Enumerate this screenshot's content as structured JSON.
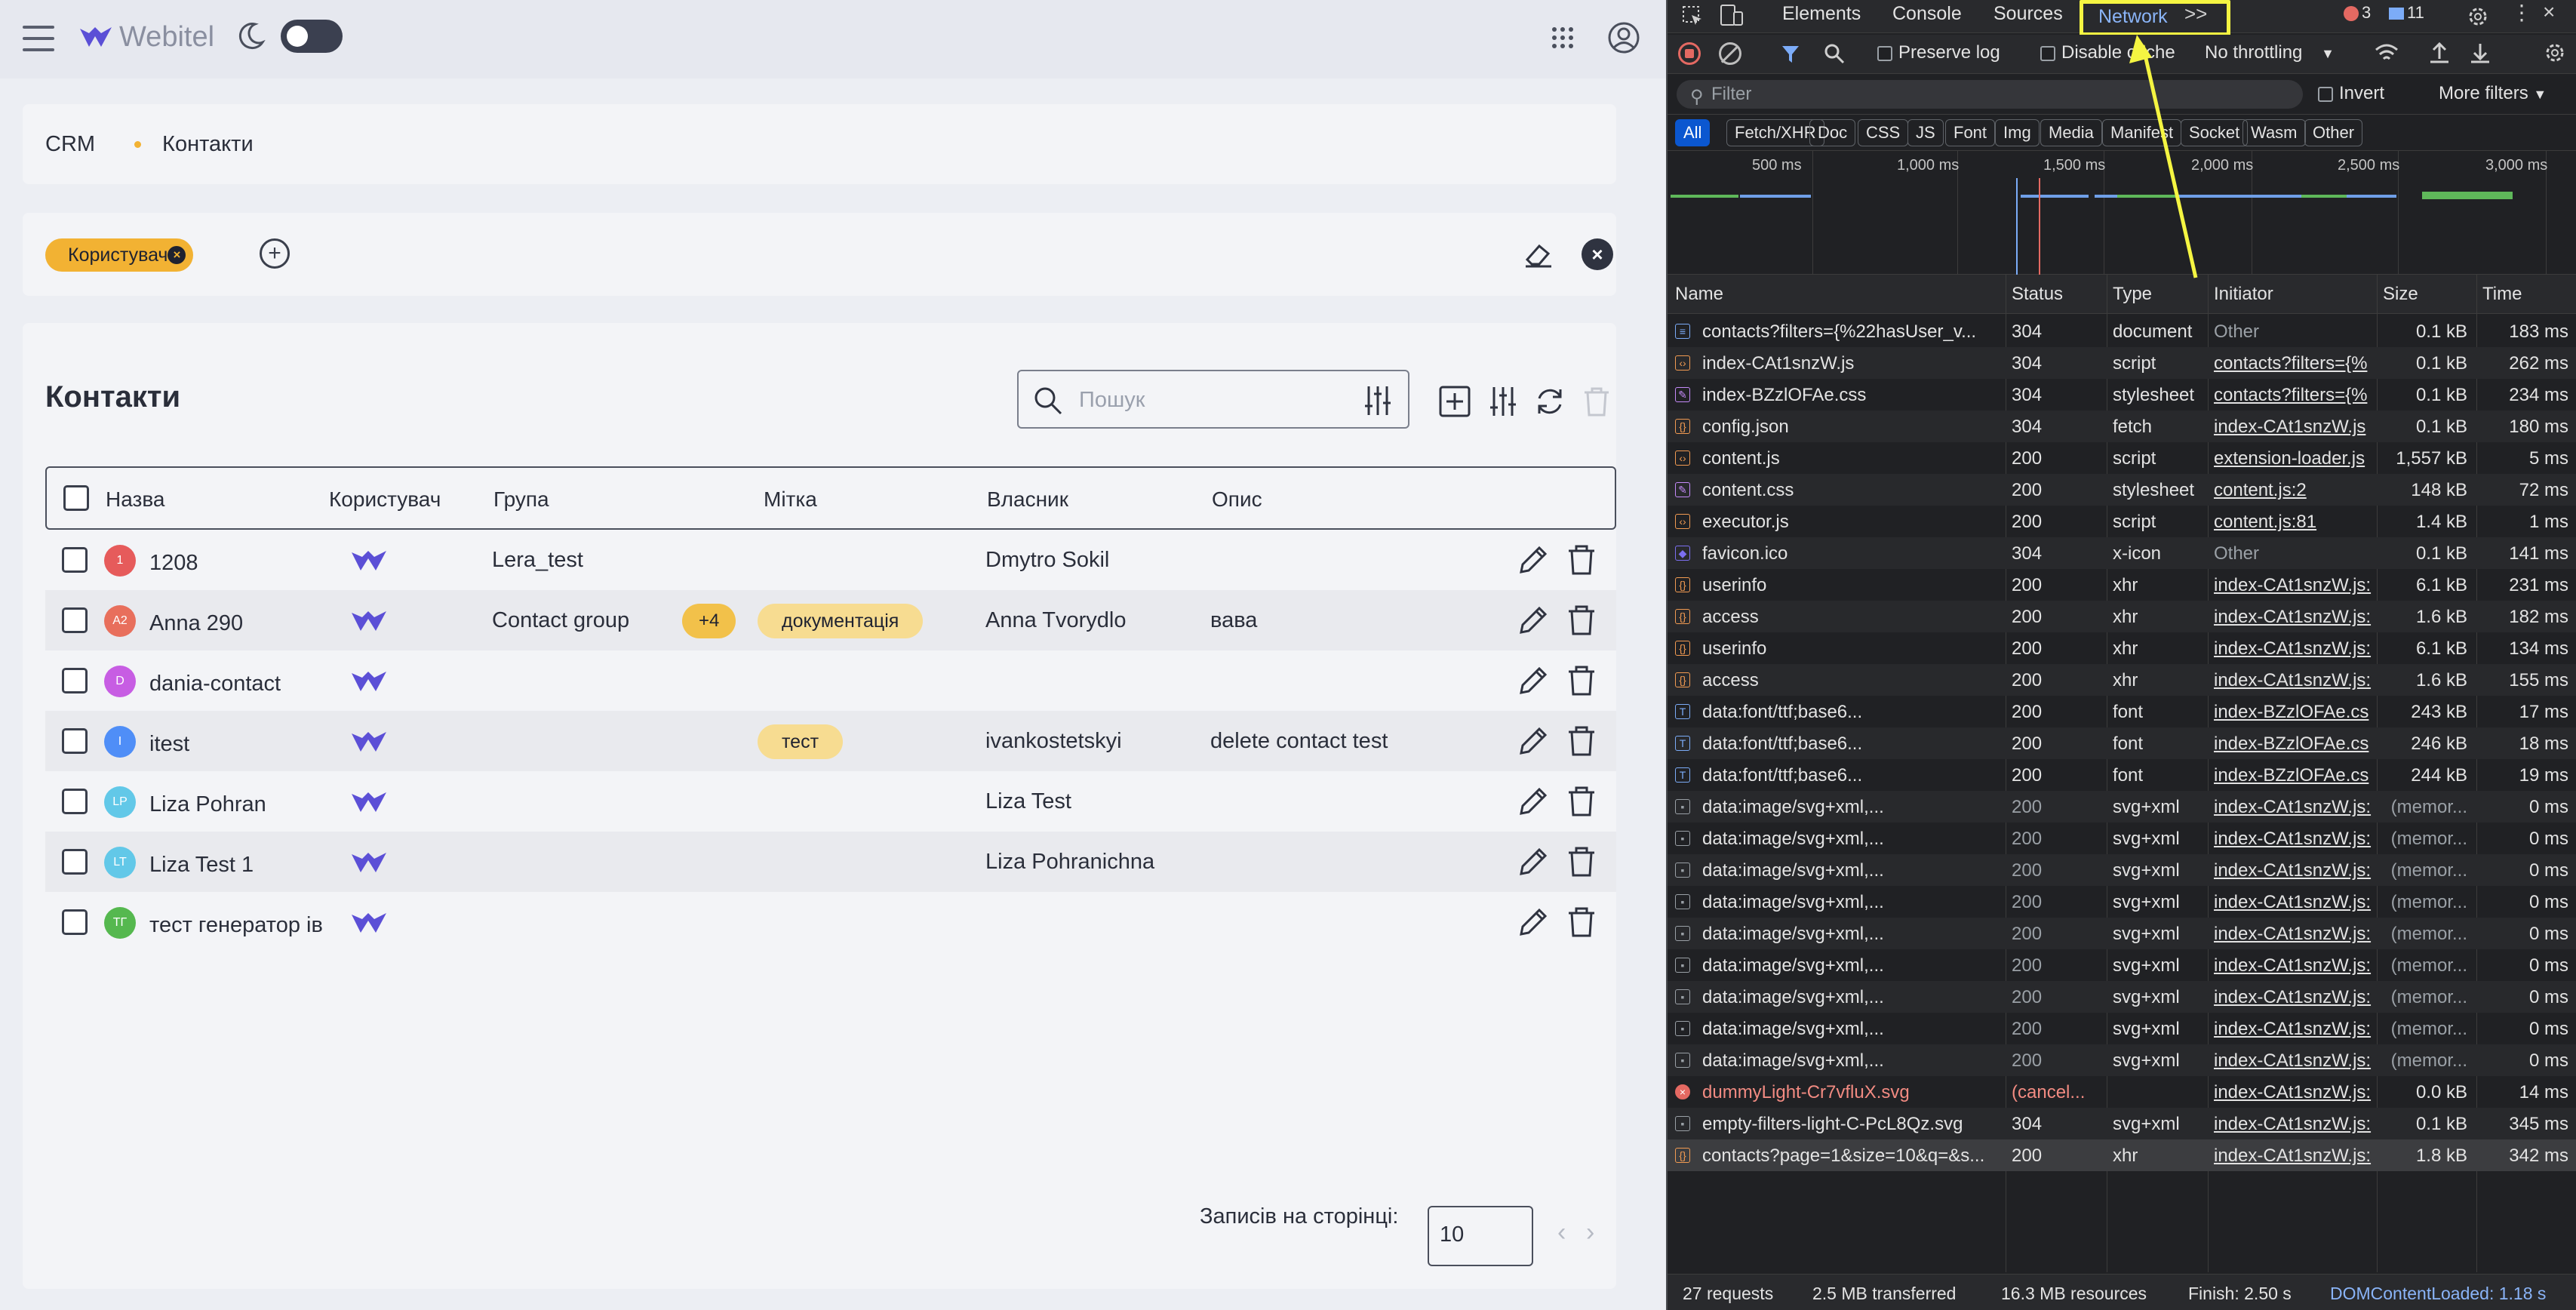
{
  "app": {
    "logo": "Webitel",
    "breadcrumb": {
      "root": "CRM",
      "current": "Контакти"
    },
    "filter_chip": "Користувач",
    "title": "Контакти",
    "search_placeholder": "Пошук",
    "columns": [
      "Назва",
      "Користувач",
      "Група",
      "Мітка",
      "Власник",
      "Опис"
    ],
    "rows": [
      {
        "initials": "1",
        "color": "#e65b5b",
        "name": "1208",
        "group": "Lera_test",
        "group_more": "",
        "tag": "",
        "owner": "Dmytro Sokil",
        "desc": ""
      },
      {
        "initials": "A2",
        "color": "#e86f5c",
        "name": "Anna 290",
        "group": "Contact group",
        "group_more": "+4",
        "tag": "документація",
        "owner": "Anna Tvorydlo",
        "desc": "вава"
      },
      {
        "initials": "D",
        "color": "#c75de3",
        "name": "dania-contact",
        "group": "",
        "group_more": "",
        "tag": "",
        "owner": "",
        "desc": ""
      },
      {
        "initials": "I",
        "color": "#4f8ef7",
        "name": "itest",
        "group": "",
        "group_more": "",
        "tag": "тест",
        "owner": "ivankostetskyi",
        "desc": "delete contact test"
      },
      {
        "initials": "LP",
        "color": "#62c8e8",
        "name": "Liza Pohran",
        "group": "",
        "group_more": "",
        "tag": "",
        "owner": "Liza Test",
        "desc": ""
      },
      {
        "initials": "LT",
        "color": "#62c8e8",
        "name": "Liza Test 1",
        "group": "",
        "group_more": "",
        "tag": "",
        "owner": "Liza Pohranichna",
        "desc": ""
      },
      {
        "initials": "ТГ",
        "color": "#55b84f",
        "name": "тест генератор ів",
        "group": "",
        "group_more": "",
        "tag": "",
        "owner": "",
        "desc": ""
      }
    ],
    "pager_label": "Записів на сторінці:",
    "page_size": "10",
    "brand_color": "#5b4fd6",
    "accent_color": "#f2b233"
  },
  "devtools": {
    "tabs": [
      "Elements",
      "Console",
      "Sources",
      "Network"
    ],
    "active_tab": "Network",
    "overflow": ">>",
    "errors": "3",
    "messages": "11",
    "preserve_log": "Preserve log",
    "disable_cache": "Disable cache",
    "throttling": "No throttling",
    "filter_placeholder": "Filter",
    "invert": "Invert",
    "more_filters": "More filters",
    "type_filters": [
      "All",
      "Fetch/XHR",
      "Doc",
      "CSS",
      "JS",
      "Font",
      "Img",
      "Media",
      "Manifest",
      "Socket",
      "Wasm",
      "Other"
    ],
    "timeline_ticks": [
      "500 ms",
      "1,000 ms",
      "1,500 ms",
      "2,000 ms",
      "2,500 ms",
      "3,000 ms"
    ],
    "columns": [
      "Name",
      "Status",
      "Type",
      "Initiator",
      "Size",
      "Time"
    ],
    "requests": [
      {
        "icon": "doc",
        "name": "contacts?filters={%22hasUser_v...",
        "status": "304",
        "type": "document",
        "initiator": "Other",
        "size": "0.1 kB",
        "time": "183 ms"
      },
      {
        "icon": "js",
        "name": "index-CAt1snzW.js",
        "status": "304",
        "type": "script",
        "initiator": "contacts?filters={%",
        "size": "0.1 kB",
        "time": "262 ms"
      },
      {
        "icon": "css",
        "name": "index-BZzlOFAe.css",
        "status": "304",
        "type": "stylesheet",
        "initiator": "contacts?filters={%",
        "size": "0.1 kB",
        "time": "234 ms"
      },
      {
        "icon": "xhr",
        "name": "config.json",
        "status": "304",
        "type": "fetch",
        "initiator": "index-CAt1snzW.js",
        "size": "0.1 kB",
        "time": "180 ms"
      },
      {
        "icon": "js",
        "name": "content.js",
        "status": "200",
        "type": "script",
        "initiator": "extension-loader.js",
        "size": "1,557 kB",
        "time": "5 ms"
      },
      {
        "icon": "css",
        "name": "content.css",
        "status": "200",
        "type": "stylesheet",
        "initiator": "content.js:2",
        "size": "148 kB",
        "time": "72 ms"
      },
      {
        "icon": "js",
        "name": "executor.js",
        "status": "200",
        "type": "script",
        "initiator": "content.js:81",
        "size": "1.4 kB",
        "time": "1 ms"
      },
      {
        "icon": "ico",
        "name": "favicon.ico",
        "status": "304",
        "type": "x-icon",
        "initiator": "Other",
        "size": "0.1 kB",
        "time": "141 ms"
      },
      {
        "icon": "xhr",
        "name": "userinfo",
        "status": "200",
        "type": "xhr",
        "initiator": "index-CAt1snzW.js:",
        "size": "6.1 kB",
        "time": "231 ms"
      },
      {
        "icon": "xhr",
        "name": "access",
        "status": "200",
        "type": "xhr",
        "initiator": "index-CAt1snzW.js:",
        "size": "1.6 kB",
        "time": "182 ms"
      },
      {
        "icon": "xhr",
        "name": "userinfo",
        "status": "200",
        "type": "xhr",
        "initiator": "index-CAt1snzW.js:",
        "size": "6.1 kB",
        "time": "134 ms"
      },
      {
        "icon": "xhr",
        "name": "access",
        "status": "200",
        "type": "xhr",
        "initiator": "index-CAt1snzW.js:",
        "size": "1.6 kB",
        "time": "155 ms"
      },
      {
        "icon": "font",
        "name": "data:font/ttf;base6...",
        "status": "200",
        "type": "font",
        "initiator": "index-BZzlOFAe.cs",
        "size": "243 kB",
        "time": "17 ms"
      },
      {
        "icon": "font",
        "name": "data:font/ttf;base6...",
        "status": "200",
        "type": "font",
        "initiator": "index-BZzlOFAe.cs",
        "size": "246 kB",
        "time": "18 ms"
      },
      {
        "icon": "font",
        "name": "data:font/ttf;base6...",
        "status": "200",
        "type": "font",
        "initiator": "index-BZzlOFAe.cs",
        "size": "244 kB",
        "time": "19 ms"
      },
      {
        "icon": "img",
        "name": "data:image/svg+xml,...",
        "status": "200",
        "type": "svg+xml",
        "initiator": "index-CAt1snzW.js:",
        "size": "(memor...",
        "time": "0 ms"
      },
      {
        "icon": "img",
        "name": "data:image/svg+xml,...",
        "status": "200",
        "type": "svg+xml",
        "initiator": "index-CAt1snzW.js:",
        "size": "(memor...",
        "time": "0 ms"
      },
      {
        "icon": "img",
        "name": "data:image/svg+xml,...",
        "status": "200",
        "type": "svg+xml",
        "initiator": "index-CAt1snzW.js:",
        "size": "(memor...",
        "time": "0 ms"
      },
      {
        "icon": "img",
        "name": "data:image/svg+xml,...",
        "status": "200",
        "type": "svg+xml",
        "initiator": "index-CAt1snzW.js:",
        "size": "(memor...",
        "time": "0 ms"
      },
      {
        "icon": "img",
        "name": "data:image/svg+xml,...",
        "status": "200",
        "type": "svg+xml",
        "initiator": "index-CAt1snzW.js:",
        "size": "(memor...",
        "time": "0 ms"
      },
      {
        "icon": "img",
        "name": "data:image/svg+xml,...",
        "status": "200",
        "type": "svg+xml",
        "initiator": "index-CAt1snzW.js:",
        "size": "(memor...",
        "time": "0 ms"
      },
      {
        "icon": "img",
        "name": "data:image/svg+xml,...",
        "status": "200",
        "type": "svg+xml",
        "initiator": "index-CAt1snzW.js:",
        "size": "(memor...",
        "time": "0 ms"
      },
      {
        "icon": "img",
        "name": "data:image/svg+xml,...",
        "status": "200",
        "type": "svg+xml",
        "initiator": "index-CAt1snzW.js:",
        "size": "(memor...",
        "time": "0 ms"
      },
      {
        "icon": "img",
        "name": "data:image/svg+xml,...",
        "status": "200",
        "type": "svg+xml",
        "initiator": "index-CAt1snzW.js:",
        "size": "(memor...",
        "time": "0 ms"
      },
      {
        "icon": "err",
        "name": "dummyLight-Cr7vfluX.svg",
        "status": "(cancel...",
        "type": "",
        "initiator": "index-CAt1snzW.js:",
        "size": "0.0 kB",
        "time": "14 ms"
      },
      {
        "icon": "img",
        "name": "empty-filters-light-C-PcL8Qz.svg",
        "status": "304",
        "type": "svg+xml",
        "initiator": "index-CAt1snzW.js:",
        "size": "0.1 kB",
        "time": "345 ms"
      },
      {
        "icon": "xhr",
        "name": "contacts?page=1&size=10&q=&s...",
        "status": "200",
        "type": "xhr",
        "initiator": "index-CAt1snzW.js:",
        "size": "1.8 kB",
        "time": "342 ms"
      }
    ],
    "footer": {
      "requests": "27 requests",
      "transferred": "2.5 MB transferred",
      "resources": "16.3 MB resources",
      "finish": "Finish: 2.50 s",
      "dcl": "DOMContentLoaded: 1.18 s"
    }
  }
}
